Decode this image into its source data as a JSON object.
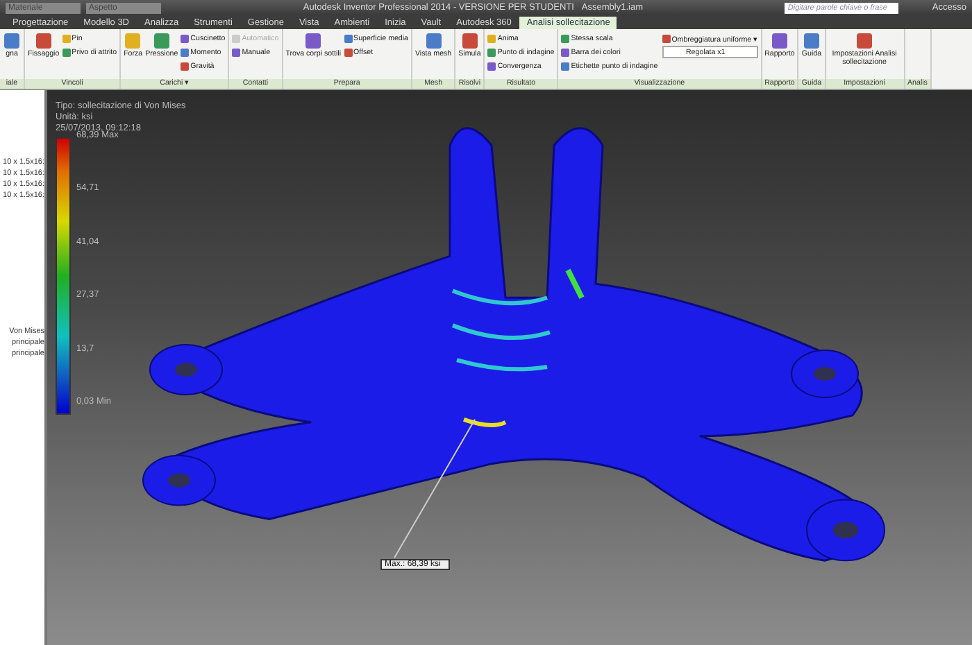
{
  "title_bar": {
    "quick_access": [
      "Materiale",
      "Aspetto"
    ],
    "title": "Autodesk Inventor Professional 2014 - VERSIONE PER STUDENTI",
    "file": "Assembly1.iam",
    "search": {
      "placeholder": "Digitare parole chiave o frase"
    },
    "sign_in": "Accesso"
  },
  "tabs": [
    {
      "label": "Progettazione",
      "selected": false
    },
    {
      "label": "Modello 3D",
      "selected": false
    },
    {
      "label": "Analizza",
      "selected": false
    },
    {
      "label": "Strumenti",
      "selected": false
    },
    {
      "label": "Gestione",
      "selected": false
    },
    {
      "label": "Vista",
      "selected": false
    },
    {
      "label": "Ambienti",
      "selected": false
    },
    {
      "label": "Inizia",
      "selected": false
    },
    {
      "label": "Vault",
      "selected": false
    },
    {
      "label": "Autodesk 360",
      "selected": false
    },
    {
      "label": "Analisi sollecitazione",
      "selected": true
    }
  ],
  "ribbon": {
    "panels": [
      {
        "label": "iale",
        "items": [
          {
            "kind": "large",
            "label": "gna"
          }
        ]
      },
      {
        "label": "Vincoli",
        "items": [
          {
            "kind": "large",
            "label": "Fissaggio"
          },
          {
            "kind": "small",
            "label": "Pin"
          },
          {
            "kind": "small",
            "label": "Privo di attrito"
          }
        ]
      },
      {
        "label": "Carichi ▾",
        "items": [
          {
            "kind": "large",
            "label": "Forza"
          },
          {
            "kind": "large",
            "label": "Pressione"
          },
          {
            "kind": "small",
            "label": "Cuscinetto"
          },
          {
            "kind": "small",
            "label": "Momento"
          },
          {
            "kind": "small",
            "label": "Gravità"
          }
        ]
      },
      {
        "label": "Contatti",
        "items": [
          {
            "kind": "small",
            "label": "Automatico",
            "disabled": true
          },
          {
            "kind": "small",
            "label": "Manuale",
            "disabled": false
          }
        ]
      },
      {
        "label": "Prepara",
        "items": [
          {
            "kind": "large",
            "label": "Trova corpi sottili"
          },
          {
            "kind": "small",
            "label": "Superficie media"
          },
          {
            "kind": "small",
            "label": "Offset"
          }
        ]
      },
      {
        "label": "Mesh",
        "items": [
          {
            "kind": "large",
            "label": "Vista mesh"
          }
        ]
      },
      {
        "label": "Risolvi",
        "items": [
          {
            "kind": "large",
            "label": "Simula"
          }
        ]
      },
      {
        "label": "Risultato",
        "items": [
          {
            "kind": "small",
            "label": "Anima"
          },
          {
            "kind": "small",
            "label": "Punto di indagine"
          },
          {
            "kind": "small",
            "label": "Convergenza"
          }
        ]
      },
      {
        "label": "Visualizzazione",
        "items": [
          {
            "kind": "small",
            "label": "Stessa scala"
          },
          {
            "kind": "small",
            "label": "Barra dei colori"
          },
          {
            "kind": "small",
            "label": "Etichette punto di indagine"
          },
          {
            "kind": "small",
            "label": "Ombreggiatura uniforme ▾"
          },
          {
            "kind": "dropdown",
            "label": "Regolata x1"
          }
        ]
      },
      {
        "label": "Rapporto",
        "items": [
          {
            "kind": "large",
            "label": "Rapporto"
          }
        ]
      },
      {
        "label": "Guida",
        "items": [
          {
            "kind": "large",
            "label": "Guida"
          }
        ]
      },
      {
        "label": "Impostazioni",
        "items": [
          {
            "kind": "large",
            "label": "Impostazioni Analisi sollecitazione"
          }
        ]
      },
      {
        "label": "Analis"
      }
    ]
  },
  "browser": {
    "items": [
      "10 x 1.5x16:",
      "10 x 1.5x16:",
      "10 x 1.5x16:",
      "10 x 1.5x16:",
      "Von Mises",
      "principale",
      "principale"
    ]
  },
  "viewport": {
    "legend": {
      "lines": [
        "Tipo: sollecitazione di Von Mises",
        "Unità: ksi",
        "25/07/2013, 09:12:18"
      ],
      "scale": [
        "68,39 Max",
        "54,71",
        "41,04",
        "27,37",
        "13,7",
        "0,03 Min"
      ]
    },
    "max_probe": "Max.: 68,39 ksi"
  }
}
